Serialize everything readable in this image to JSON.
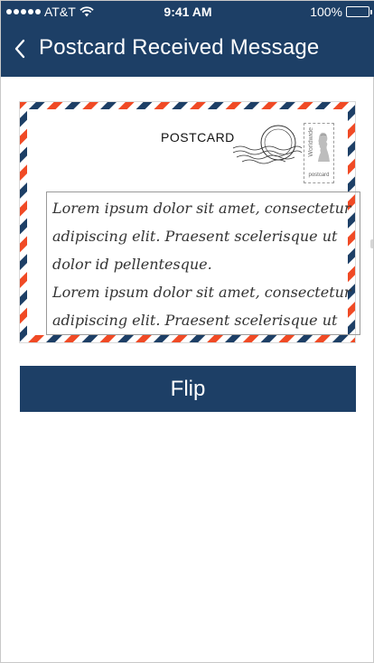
{
  "status_bar": {
    "carrier": "AT&T",
    "time": "9:41 AM",
    "battery": "100%",
    "battery_level": 1.0
  },
  "nav": {
    "title": "Postcard Received Message",
    "back_icon": "chevron-left-icon"
  },
  "postcard": {
    "title": "POSTCARD",
    "stamp_text": "Worldwide",
    "stamp_label": "postcard",
    "message": "Lorem ipsum dolor sit amet, consectetur adipiscing elit. Praesent scelerisque ut dolor id pellentesque.\nLorem ipsum dolor sit amet, consectetur adipiscing elit. Praesent scelerisque ut",
    "colors": {
      "stripe_red": "#f04a25",
      "stripe_navy": "#1d3f66"
    }
  },
  "actions": {
    "flip_label": "Flip"
  },
  "theme": {
    "primary": "#1d3f66",
    "background": "#ffffff"
  }
}
